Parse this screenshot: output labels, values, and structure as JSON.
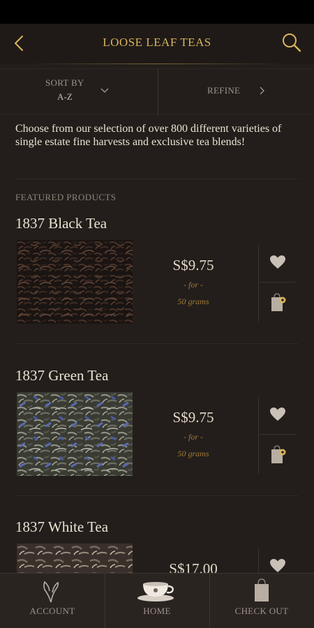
{
  "header": {
    "title": "LOOSE LEAF TEAS"
  },
  "filters": {
    "sort_label": "SORT BY",
    "sort_value": "A-Z",
    "refine_label": "REFINE"
  },
  "intro": "Choose from our selection of over 800 different varieties of single estate fine harvests and exclusive tea blends!",
  "featured_label": "FEATURED PRODUCTS",
  "products": [
    {
      "name": "1837 Black Tea",
      "price": "S$9.75",
      "for": "- for -",
      "qty": "50  grams"
    },
    {
      "name": "1837 Green Tea",
      "price": "S$9.75",
      "for": "- for -",
      "qty": "50  grams"
    },
    {
      "name": "1837 White Tea",
      "price": "S$17.00",
      "for": "",
      "qty": ""
    }
  ],
  "nav": {
    "account": "ACCOUNT",
    "home": "HOME",
    "checkout": "CHECK OUT"
  },
  "colors": {
    "accent_gold": "#d9b45c",
    "background": "#231e1b",
    "text": "#ece2d3",
    "muted": "#9d9288"
  }
}
